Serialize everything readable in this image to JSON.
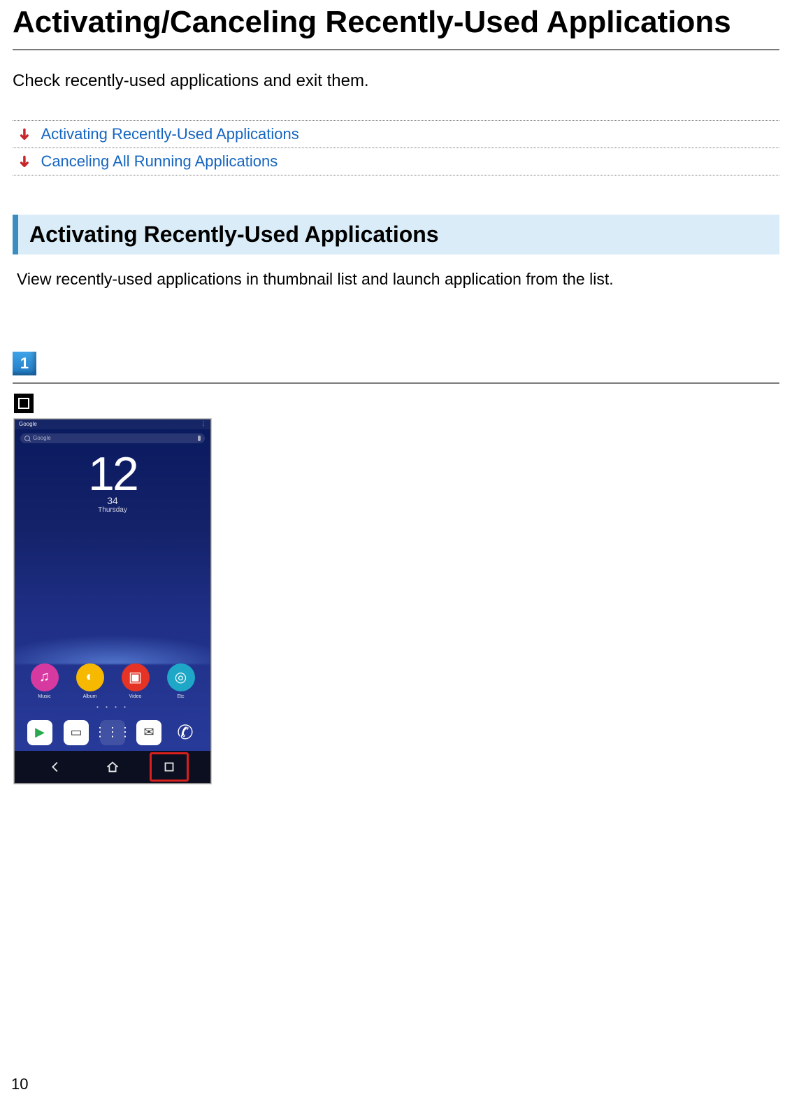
{
  "title": "Activating/Canceling Recently-Used Applications",
  "intro": "Check recently-used applications and exit them.",
  "toc": [
    {
      "label": "Activating Recently-Used Applications"
    },
    {
      "label": "Canceling All Running Applications"
    }
  ],
  "section": {
    "heading": "Activating Recently-Used Applications",
    "desc": "View recently-used applications in thumbnail list and launch application from the list."
  },
  "step": {
    "number": "1"
  },
  "phone": {
    "status_left": "Google",
    "status_right": "⋮",
    "search_placeholder": "Google",
    "clock_time": "12",
    "clock_day": "34",
    "clock_date": "Thursday",
    "apps": [
      {
        "label": "Music"
      },
      {
        "label": "Album"
      },
      {
        "label": "Video"
      },
      {
        "label": "Etc"
      }
    ],
    "page_dots": "• • • •"
  },
  "page_number": "10"
}
